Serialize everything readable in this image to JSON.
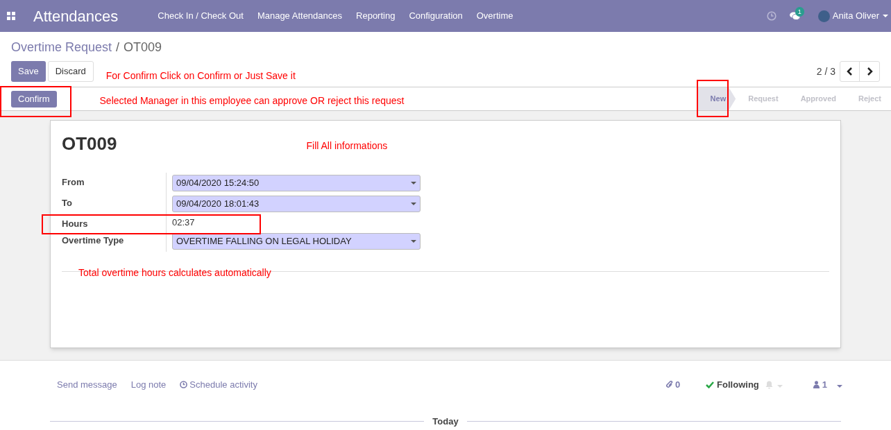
{
  "navbar": {
    "app_title": "Attendances",
    "menu": [
      "Check In / Check Out",
      "Manage Attendances",
      "Reporting",
      "Configuration",
      "Overtime"
    ],
    "messages_badge": "1",
    "user": "Anita Oliver"
  },
  "breadcrumb": {
    "parent": "Overtime Request",
    "separator": "/",
    "current": "OT009"
  },
  "buttons": {
    "save": "Save",
    "discard": "Discard"
  },
  "pager": {
    "text": "2 / 3"
  },
  "notes": {
    "save_note": "For Confirm Click on Confirm or Just Save it",
    "confirm_note": "Selected Manager in this employee can approve OR reject this request",
    "fill_note": "Fill All informations",
    "hours_note": "Total overtime hours calculates automatically"
  },
  "header": {
    "confirm": "Confirm",
    "stages": [
      {
        "label": "New",
        "selected": true
      },
      {
        "label": "Request",
        "selected": false
      },
      {
        "label": "Approved",
        "selected": false
      },
      {
        "label": "Reject",
        "selected": false
      }
    ]
  },
  "sheet": {
    "title": "OT009",
    "fields": [
      {
        "label": "From",
        "kind": "select",
        "value": "09/04/2020 15:24:50"
      },
      {
        "label": "To",
        "kind": "select",
        "value": "09/04/2020 18:01:43"
      },
      {
        "label": "Hours",
        "kind": "text",
        "value": "02:37"
      },
      {
        "label": "Overtime Type",
        "kind": "select",
        "value": "OVERTIME FALLING ON LEGAL HOLIDAY"
      }
    ]
  },
  "chatter": {
    "send_message": "Send message",
    "log_note": "Log note",
    "schedule_activity": "Schedule activity",
    "attachments": "0",
    "following": "Following",
    "followers": "1",
    "today": "Today"
  }
}
